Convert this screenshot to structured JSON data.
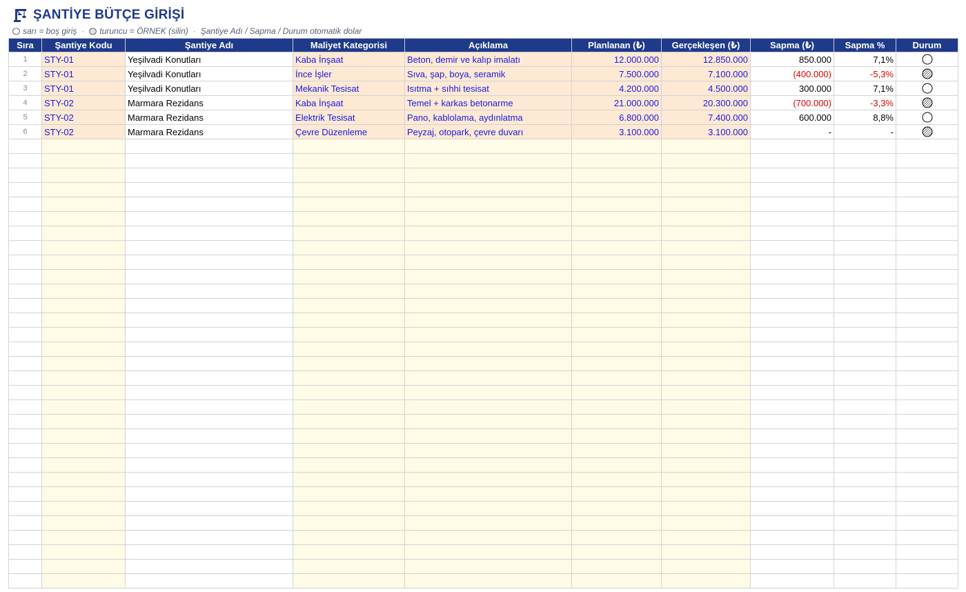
{
  "header": {
    "title": "ŞANTİYE BÜTÇE GİRİŞİ",
    "icon": "construction-crane-icon"
  },
  "legend": {
    "yellow_text": "sarı = boş giriş",
    "orange_text": "turuncu = ÖRNEK (silin)",
    "auto_text": "Şantiye Adı / Sapma / Durum otomatik dolar",
    "separator": "·"
  },
  "colors": {
    "header_bg": "#1f3a8a",
    "example_input_bg": "#fde9d4",
    "empty_input_bg": "#fefbe6",
    "input_text": "#1a1adf",
    "negative_text": "#e00000"
  },
  "table": {
    "columns": [
      "Sıra",
      "Şantiye Kodu",
      "Şantiye Adı",
      "Maliyet Kategorisi",
      "Açıklama",
      "Planlanan (₺)",
      "Gerçekleşen (₺)",
      "Sapma (₺)",
      "Sapma %",
      "Durum"
    ],
    "rows": [
      {
        "no": "1",
        "code": "STY-01",
        "name": "Yeşilvadi Konutları",
        "category": "Kaba İnşaat",
        "desc": "Beton, demir ve kalıp imalatı",
        "planned": "12.000.000",
        "actual": "12.850.000",
        "variance": "850.000",
        "variance_pct": "7,1%",
        "negative": false,
        "status": "empty-circle-icon"
      },
      {
        "no": "2",
        "code": "STY-01",
        "name": "Yeşilvadi Konutları",
        "category": "İnce İşler",
        "desc": "Sıva, şap, boya, seramik",
        "planned": "7.500.000",
        "actual": "7.100.000",
        "variance": "(400.000)",
        "variance_pct": "-5,3%",
        "negative": true,
        "status": "hatched-circle-icon"
      },
      {
        "no": "3",
        "code": "STY-01",
        "name": "Yeşilvadi Konutları",
        "category": "Mekanik Tesisat",
        "desc": "Isıtma + sıhhi tesisat",
        "planned": "4.200.000",
        "actual": "4.500.000",
        "variance": "300.000",
        "variance_pct": "7,1%",
        "negative": false,
        "status": "empty-circle-icon"
      },
      {
        "no": "4",
        "code": "STY-02",
        "name": "Marmara Rezidans",
        "category": "Kaba İnşaat",
        "desc": "Temel + karkas betonarme",
        "planned": "21.000.000",
        "actual": "20.300.000",
        "variance": "(700.000)",
        "variance_pct": "-3,3%",
        "negative": true,
        "status": "hatched-circle-icon"
      },
      {
        "no": "5",
        "code": "STY-02",
        "name": "Marmara Rezidans",
        "category": "Elektrik Tesisat",
        "desc": "Pano, kablolama, aydınlatma",
        "planned": "6.800.000",
        "actual": "7.400.000",
        "variance": "600.000",
        "variance_pct": "8,8%",
        "negative": false,
        "status": "empty-circle-icon"
      },
      {
        "no": "6",
        "code": "STY-02",
        "name": "Marmara Rezidans",
        "category": "Çevre Düzenleme",
        "desc": "Peyzaj, otopark, çevre duvarı",
        "planned": "3.100.000",
        "actual": "3.100.000",
        "variance": "-",
        "variance_pct": "-",
        "negative": false,
        "status": "hatched-circle-icon"
      }
    ]
  }
}
